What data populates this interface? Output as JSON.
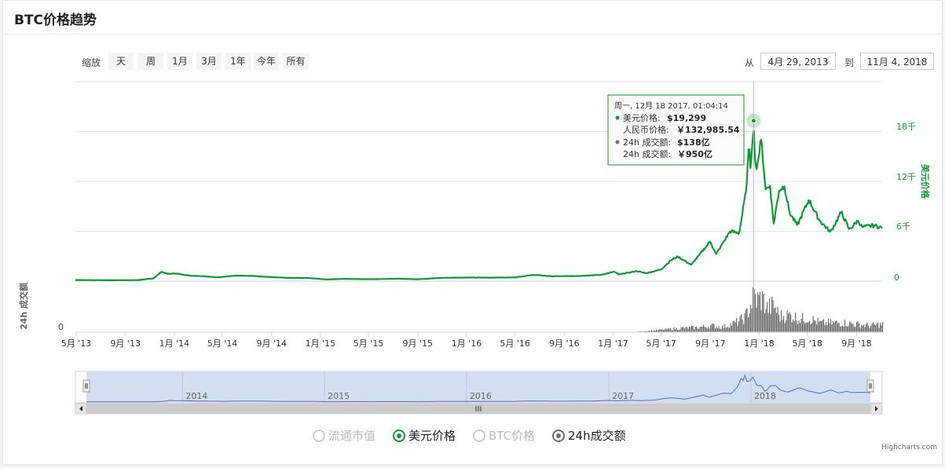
{
  "title": "BTC价格趋势",
  "range_selector": {
    "zoom_label": "缩放",
    "buttons": [
      "天",
      "周",
      "1月",
      "3月",
      "1年",
      "今年",
      "所有"
    ],
    "from_label": "从",
    "from_date": "4月 29, 2013",
    "to_label": "到",
    "to_date": "11月 4, 2018"
  },
  "tooltip": {
    "header": "周一, 12月 18 2017, 01:04:14",
    "usd_label": "美元价格:",
    "usd_value": "$19,299",
    "cny_label": "人民币价格:",
    "cny_value": "￥132,985.54",
    "vol_label": "24h 成交额:",
    "vol_value": "$138亿",
    "vol_cny_label": "24h 成交额:",
    "vol_cny_value": "￥950亿"
  },
  "legend": [
    {
      "label": "流通市值",
      "active": false
    },
    {
      "label": "美元价格",
      "active": true
    },
    {
      "label": "BTC价格",
      "active": false
    },
    {
      "label": "24h成交额",
      "active": true
    }
  ],
  "credit": "Highcharts.com",
  "colors": {
    "price": "#12963a",
    "volume": "#6e6e6e",
    "navigator": "#4a6fc0",
    "navigator_bg": "#d1dcf0"
  },
  "chart_data": {
    "type": "line",
    "x_tick_labels": [
      "5月 '13",
      "9月 '13",
      "1月 '14",
      "5月 '14",
      "9月 '14",
      "1月 '15",
      "5月 '15",
      "9月 '15",
      "1月 '16",
      "5月 '16",
      "9月 '16",
      "1月 '17",
      "5月 '17",
      "9月 '17",
      "1月 '18",
      "5月 '18",
      "9月 '18"
    ],
    "y_right_label": "美元价格",
    "y_right_ticks": [
      "0",
      "6千",
      "12千",
      "18千"
    ],
    "y_right_range": [
      0,
      24000
    ],
    "y_left_label": "24h 成交额",
    "y_left_ticks": [
      "0"
    ],
    "navigator_labels": [
      "2014",
      "2015",
      "2016",
      "2017",
      "2018"
    ],
    "x_range": [
      "2013-04-29",
      "2018-11-04"
    ],
    "highlight": {
      "date": "2017-12-18",
      "value": 19299
    },
    "series": [
      {
        "name": "美元价格",
        "points": [
          [
            "2013-04-29",
            135
          ],
          [
            "2013-06-01",
            122
          ],
          [
            "2013-08-01",
            105
          ],
          [
            "2013-10-01",
            125
          ],
          [
            "2013-11-10",
            330
          ],
          [
            "2013-11-30",
            1130
          ],
          [
            "2013-12-15",
            870
          ],
          [
            "2014-01-05",
            920
          ],
          [
            "2014-02-10",
            650
          ],
          [
            "2014-03-15",
            600
          ],
          [
            "2014-04-15",
            450
          ],
          [
            "2014-06-01",
            650
          ],
          [
            "2014-07-15",
            620
          ],
          [
            "2014-09-01",
            480
          ],
          [
            "2014-10-15",
            390
          ],
          [
            "2014-12-01",
            380
          ],
          [
            "2015-01-15",
            200
          ],
          [
            "2015-03-01",
            270
          ],
          [
            "2015-05-01",
            235
          ],
          [
            "2015-07-15",
            290
          ],
          [
            "2015-09-01",
            230
          ],
          [
            "2015-11-05",
            400
          ],
          [
            "2016-01-01",
            430
          ],
          [
            "2016-03-01",
            420
          ],
          [
            "2016-05-01",
            450
          ],
          [
            "2016-06-17",
            750
          ],
          [
            "2016-08-01",
            580
          ],
          [
            "2016-10-01",
            610
          ],
          [
            "2016-12-01",
            750
          ],
          [
            "2017-01-04",
            1130
          ],
          [
            "2017-01-15",
            800
          ],
          [
            "2017-03-01",
            1200
          ],
          [
            "2017-03-25",
            950
          ],
          [
            "2017-05-01",
            1400
          ],
          [
            "2017-05-25",
            2500
          ],
          [
            "2017-06-12",
            2950
          ],
          [
            "2017-07-15",
            1950
          ],
          [
            "2017-08-05",
            3200
          ],
          [
            "2017-09-01",
            4800
          ],
          [
            "2017-09-15",
            3200
          ],
          [
            "2017-10-20",
            6000
          ],
          [
            "2017-11-12",
            5800
          ],
          [
            "2017-11-29",
            10800
          ],
          [
            "2017-12-07",
            16500
          ],
          [
            "2017-12-10",
            13500
          ],
          [
            "2017-12-18",
            19299
          ],
          [
            "2017-12-22",
            13500
          ],
          [
            "2017-12-28",
            14200
          ],
          [
            "2018-01-06",
            17100
          ],
          [
            "2018-01-17",
            11000
          ],
          [
            "2018-01-28",
            11500
          ],
          [
            "2018-02-06",
            6900
          ],
          [
            "2018-02-20",
            11000
          ],
          [
            "2018-03-05",
            11400
          ],
          [
            "2018-03-18",
            8200
          ],
          [
            "2018-04-06",
            6700
          ],
          [
            "2018-05-05",
            9800
          ],
          [
            "2018-05-30",
            7400
          ],
          [
            "2018-06-28",
            5900
          ],
          [
            "2018-07-25",
            8300
          ],
          [
            "2018-08-14",
            6200
          ],
          [
            "2018-09-05",
            7300
          ],
          [
            "2018-09-15",
            6500
          ],
          [
            "2018-10-15",
            6700
          ],
          [
            "2018-11-04",
            6400
          ]
        ]
      },
      {
        "name": "24h成交额",
        "points": [
          [
            "2017-03-01",
            0.2
          ],
          [
            "2017-05-01",
            0.9
          ],
          [
            "2017-06-15",
            1.5
          ],
          [
            "2017-08-01",
            1.8
          ],
          [
            "2017-09-01",
            2.5
          ],
          [
            "2017-10-01",
            2.0
          ],
          [
            "2017-11-01",
            3.5
          ],
          [
            "2017-11-25",
            5.5
          ],
          [
            "2017-12-10",
            10.5
          ],
          [
            "2017-12-18",
            13.8
          ],
          [
            "2017-12-25",
            12.0
          ],
          [
            "2018-01-06",
            13.0
          ],
          [
            "2018-01-20",
            9.0
          ],
          [
            "2018-02-06",
            10.0
          ],
          [
            "2018-02-20",
            6.0
          ],
          [
            "2018-03-15",
            6.5
          ],
          [
            "2018-04-15",
            5.0
          ],
          [
            "2018-05-01",
            5.5
          ],
          [
            "2018-06-01",
            3.5
          ],
          [
            "2018-07-01",
            3.5
          ],
          [
            "2018-08-01",
            3.5
          ],
          [
            "2018-09-01",
            3.0
          ],
          [
            "2018-10-01",
            2.5
          ],
          [
            "2018-11-04",
            3.0
          ]
        ]
      }
    ]
  }
}
